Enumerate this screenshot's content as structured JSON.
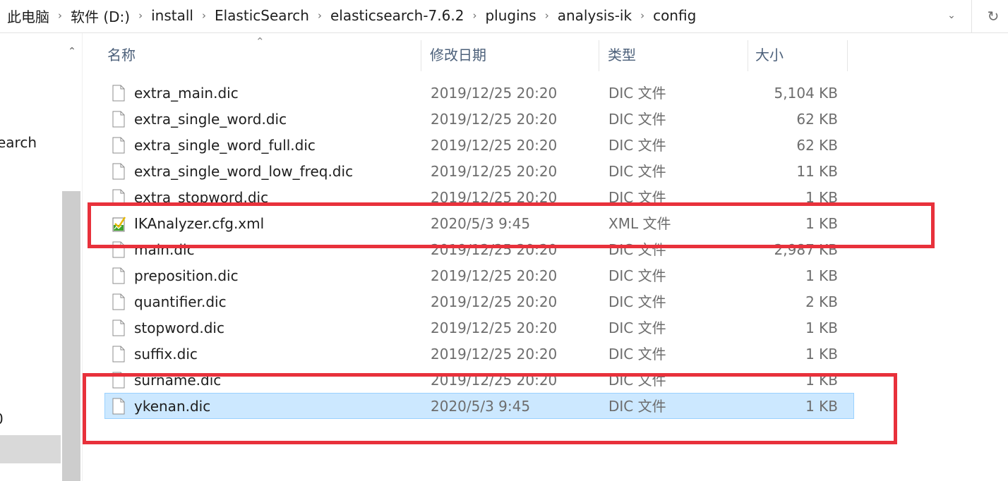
{
  "address_bar": {
    "crumbs": [
      "此电脑",
      "软件 (D:)",
      "install",
      "ElasticSearch",
      "elasticsearch-7.6.2",
      "plugins",
      "analysis-ik",
      "config"
    ],
    "separator": "›",
    "dropdown_glyph": "⌄",
    "refresh_glyph": "↻"
  },
  "nav_pane": {
    "partial_items": [
      "earch",
      "0"
    ],
    "scroll_up_glyph": "⌃"
  },
  "columns": {
    "name": "名称",
    "date": "修改日期",
    "type": "类型",
    "size": "大小",
    "sort_glyph": "⌃"
  },
  "files": [
    {
      "name": "extra_main.dic",
      "date": "2019/12/25 20:20",
      "type": "DIC 文件",
      "size": "5,104 KB",
      "icon": "file-icon"
    },
    {
      "name": "extra_single_word.dic",
      "date": "2019/12/25 20:20",
      "type": "DIC 文件",
      "size": "62 KB",
      "icon": "file-icon"
    },
    {
      "name": "extra_single_word_full.dic",
      "date": "2019/12/25 20:20",
      "type": "DIC 文件",
      "size": "62 KB",
      "icon": "file-icon"
    },
    {
      "name": "extra_single_word_low_freq.dic",
      "date": "2019/12/25 20:20",
      "type": "DIC 文件",
      "size": "11 KB",
      "icon": "file-icon"
    },
    {
      "name": "extra_stopword.dic",
      "date": "2019/12/25 20:20",
      "type": "DIC 文件",
      "size": "1 KB",
      "icon": "file-icon"
    },
    {
      "name": "IKAnalyzer.cfg.xml",
      "date": "2020/5/3 9:45",
      "type": "XML 文件",
      "size": "1 KB",
      "icon": "xml-file-icon"
    },
    {
      "name": "main.dic",
      "date": "2019/12/25 20:20",
      "type": "DIC 文件",
      "size": "2,987 KB",
      "icon": "file-icon"
    },
    {
      "name": "preposition.dic",
      "date": "2019/12/25 20:20",
      "type": "DIC 文件",
      "size": "1 KB",
      "icon": "file-icon"
    },
    {
      "name": "quantifier.dic",
      "date": "2019/12/25 20:20",
      "type": "DIC 文件",
      "size": "2 KB",
      "icon": "file-icon"
    },
    {
      "name": "stopword.dic",
      "date": "2019/12/25 20:20",
      "type": "DIC 文件",
      "size": "1 KB",
      "icon": "file-icon"
    },
    {
      "name": "suffix.dic",
      "date": "2019/12/25 20:20",
      "type": "DIC 文件",
      "size": "1 KB",
      "icon": "file-icon"
    },
    {
      "name": "surname.dic",
      "date": "2019/12/25 20:20",
      "type": "DIC 文件",
      "size": "1 KB",
      "icon": "file-icon"
    },
    {
      "name": "ykenan.dic",
      "date": "2020/5/3 9:45",
      "type": "DIC 文件",
      "size": "1 KB",
      "icon": "file-icon",
      "selected": true
    }
  ],
  "colors": {
    "selection_bg": "#cce8ff",
    "selection_border": "#99d1ff",
    "highlight_red": "#e8313b",
    "header_text": "#4c607a"
  }
}
